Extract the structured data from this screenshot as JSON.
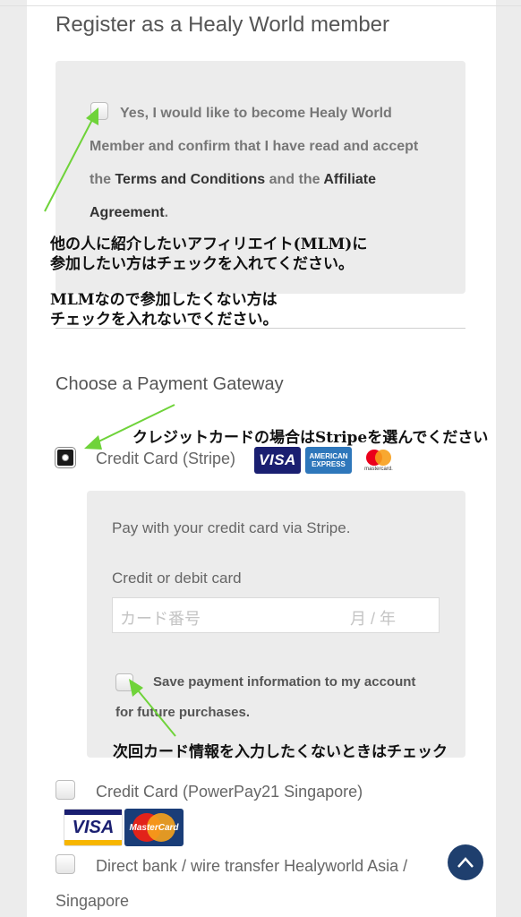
{
  "register": {
    "title": "Register as a Healy World member",
    "checkbox_text_1": "Yes, I would like to become Healy World Member and confirm that I have read and accept the ",
    "terms_link": "Terms and Conditions",
    "and_the": " and the ",
    "affiliate_link": "Affiliate Agreement",
    "period": "."
  },
  "annotations": {
    "mlm_line1": "他の人に紹介したいアフィリエイト(MLM)に",
    "mlm_line2": "参加したい方はチェックを入れてください。",
    "no_mlm_line1": "MLMなので参加したくない方は",
    "no_mlm_line2": "チェックを入れないでください。",
    "stripe_note": "クレジットカードの場合はStripeを選んでください",
    "save_note": "次回カード情報を入力したくないときはチェック"
  },
  "payment": {
    "heading": "Choose a Payment Gateway",
    "stripe_label": "Credit Card (Stripe)",
    "stripe_desc": "Pay with your credit card via Stripe.",
    "card_field_label": "Credit or debit card",
    "card_number_placeholder": "カード番号",
    "expiry_placeholder": "月 / 年",
    "save_info_line1": "Save payment information to my account",
    "save_info_line2": "for future purchases.",
    "powerpay_label": "Credit Card (PowerPay21 Singapore)",
    "bank_label_line1": "Direct bank / wire transfer Healyworld Asia /",
    "bank_label_line2": "Singapore"
  },
  "logos": {
    "visa": "VISA",
    "amex_line1": "AMERICAN",
    "amex_line2": "EXPRESS",
    "mastercard": "mastercard.",
    "mastercard_old": "MasterCard"
  },
  "colors": {
    "annotation_arrow": "#6fd33a",
    "scroll_button": "#1f3f6e"
  },
  "icons": {
    "scroll_top": "chevron-up-icon"
  }
}
